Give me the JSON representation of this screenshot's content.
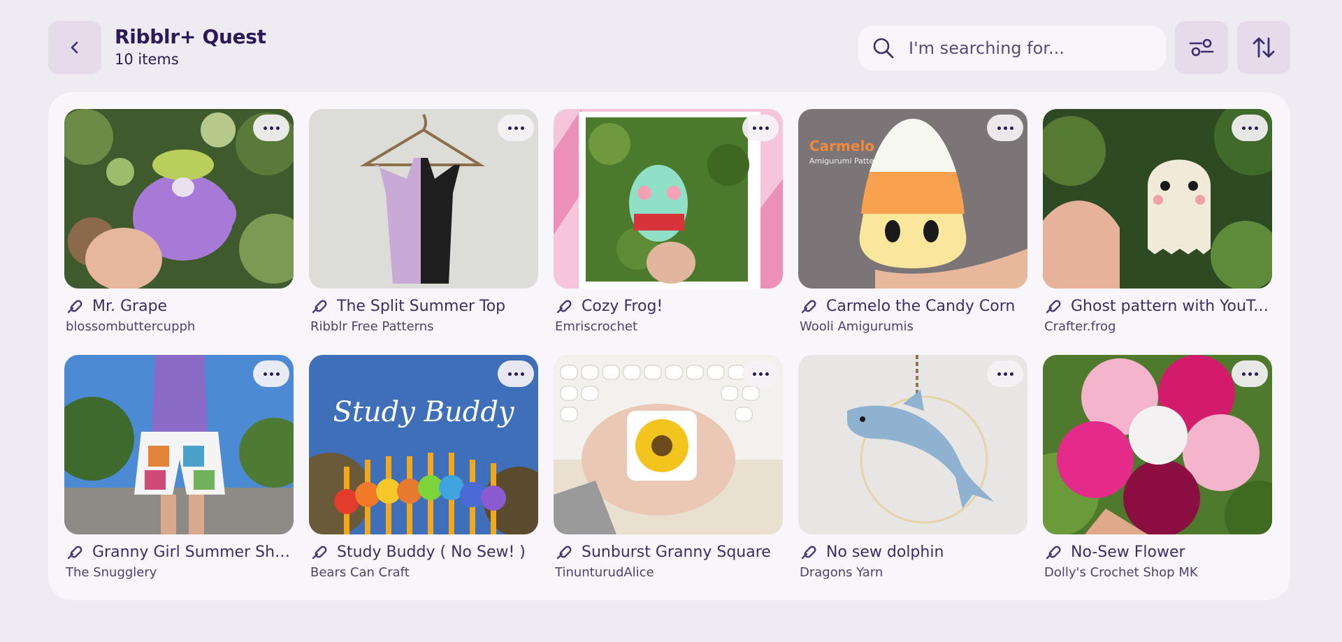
{
  "header": {
    "title": "Ribblr+ Quest",
    "count": "10 items",
    "back_icon": "chevron-left-icon",
    "filter_icon": "sliders-icon",
    "sort_icon": "sort-arrows-icon"
  },
  "search": {
    "placeholder": "I'm searching for...",
    "value": "",
    "icon": "search-icon"
  },
  "colors": {
    "background": "#efebf3",
    "panel": "#f8f6fa",
    "accent": "#2b1a57",
    "button_bg": "#e5dbeb"
  },
  "items": [
    {
      "title": "Mr. Grape",
      "author": "blossombuttercupph",
      "link_icon": "pin-link-icon"
    },
    {
      "title": "The Split Summer Top",
      "author": "Ribblr Free Patterns",
      "link_icon": "pin-link-icon"
    },
    {
      "title": "Cozy Frog!",
      "author": "Emriscrochet",
      "link_icon": "pin-link-icon"
    },
    {
      "title": "Carmelo the Candy Corn",
      "author": "Wooli Amigurumis",
      "link_icon": "pin-link-icon",
      "thumb_text": {
        "brand": "Carmelo",
        "sub": "Amigurumi Pattern"
      }
    },
    {
      "title": "Ghost pattern with YouTu...",
      "author": "Crafter.frog",
      "link_icon": "pin-link-icon"
    },
    {
      "title": "Granny Girl Summer Sho...",
      "author": "The Snugglery",
      "link_icon": "pin-link-icon"
    },
    {
      "title": "Study Buddy ( No Sew! )",
      "author": "Bears Can Craft",
      "link_icon": "pin-link-icon",
      "thumb_text": {
        "brand": "Study Buddy"
      }
    },
    {
      "title": "Sunburst Granny Square",
      "author": "TinunturudAlice",
      "link_icon": "pin-link-icon"
    },
    {
      "title": "No sew dolphin",
      "author": "Dragons Yarn",
      "link_icon": "pin-link-icon"
    },
    {
      "title": "No-Sew Flower",
      "author": "Dolly's Crochet Shop MK",
      "link_icon": "pin-link-icon"
    }
  ]
}
